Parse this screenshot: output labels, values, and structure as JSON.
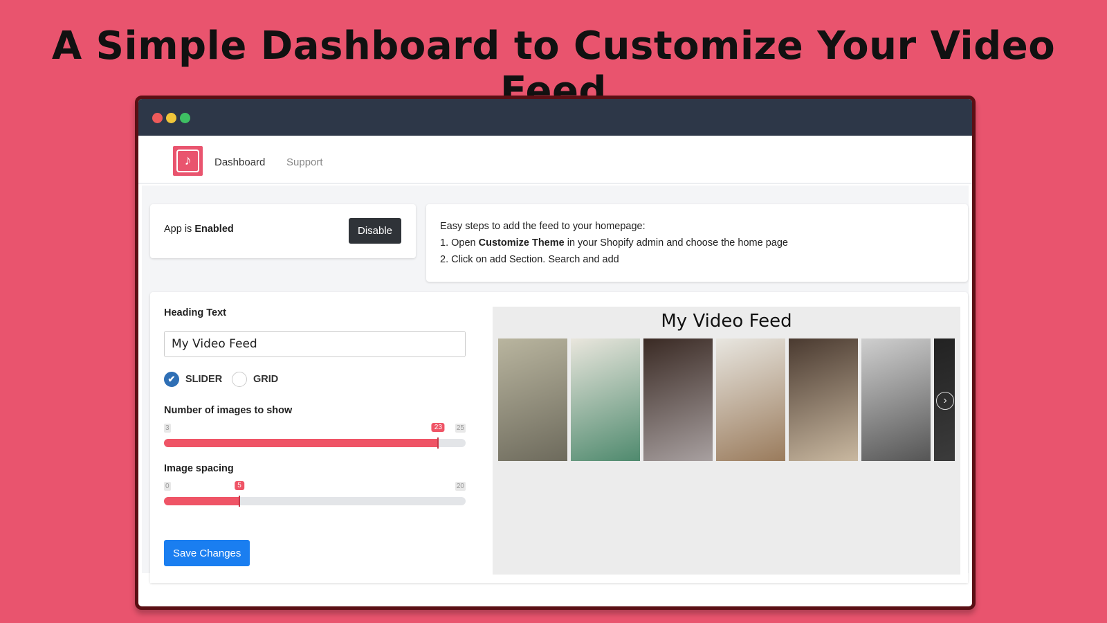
{
  "headline": "A Simple Dashboard to Customize Your Video Feed",
  "window": {
    "controls": [
      "close",
      "minimize",
      "maximize"
    ],
    "colors": {
      "close": "#ee5a5a",
      "minimize": "#f0c63a",
      "maximize": "#3ebf63"
    }
  },
  "nav": {
    "logo_icon": "tiktok-calendar-icon",
    "items": [
      {
        "label": "Dashboard",
        "active": true
      },
      {
        "label": "Support",
        "active": false
      }
    ]
  },
  "status": {
    "prefix": "App is ",
    "state": "Enabled",
    "button": "Disable"
  },
  "steps": {
    "intro": "Easy steps to add the feed to your homepage:",
    "step1_a": "1. Open ",
    "step1_b": "Customize Theme",
    "step1_c": " in your Shopify admin and choose the home page",
    "step2": "2. Click on add Section. Search and add"
  },
  "settings": {
    "heading_label": "Heading Text",
    "heading_value": "My Video Feed",
    "layout_options": [
      {
        "label": "SLIDER",
        "checked": true
      },
      {
        "label": "GRID",
        "checked": false
      }
    ],
    "images_slider": {
      "label": "Number of images to show",
      "min": 3,
      "max": 25,
      "value": 23,
      "min_label": "3",
      "max_label": "25",
      "value_label": "23"
    },
    "spacing_slider": {
      "label": "Image spacing",
      "min": 0,
      "max": 20,
      "value": 5,
      "min_label": "0",
      "max_label": "20",
      "value_label": "5"
    },
    "save": "Save Changes"
  },
  "preview": {
    "title": "My Video Feed",
    "next_icon": "chevron-right-icon",
    "tiles": [
      {
        "colors": [
          "#b9b59f",
          "#6d6a5c"
        ]
      },
      {
        "colors": [
          "#e9e6dd",
          "#4f8a6e"
        ]
      },
      {
        "colors": [
          "#3a2a24",
          "#a8a0a0"
        ]
      },
      {
        "colors": [
          "#e8e6e0",
          "#9a7b5c"
        ]
      },
      {
        "colors": [
          "#4a3a30",
          "#c9b8a0"
        ]
      },
      {
        "colors": [
          "#cfcfcf",
          "#555555"
        ]
      },
      {
        "colors": [
          "#222222",
          "#3b3b3b"
        ]
      }
    ]
  },
  "colors": {
    "accent": "#ef5466",
    "primary": "#1a7ef0",
    "titlebar": "#2d3748"
  }
}
